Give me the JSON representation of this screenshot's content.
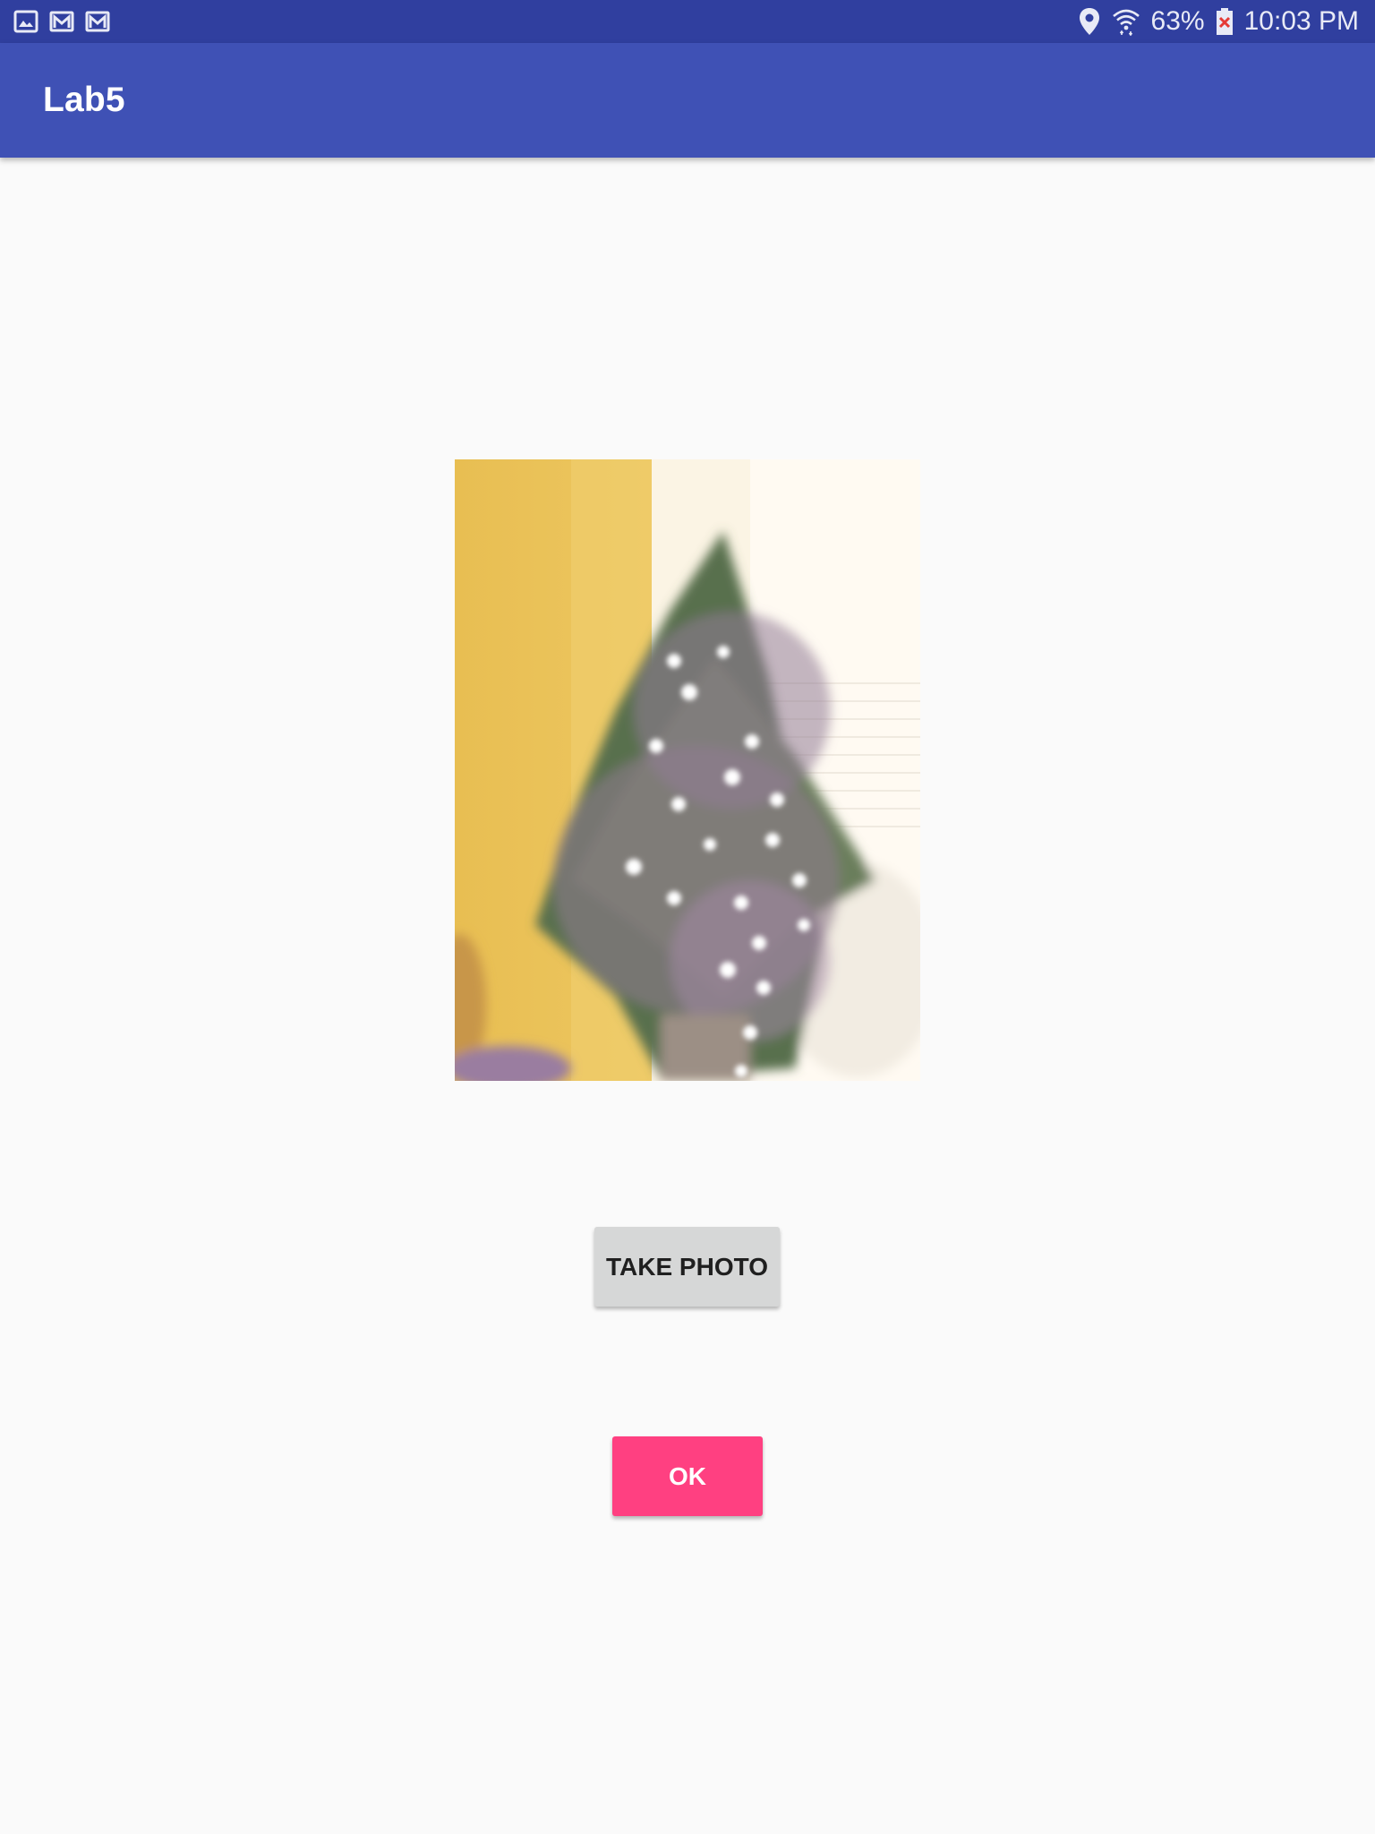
{
  "status_bar": {
    "notification_icons": [
      "gallery-icon",
      "gmail-icon",
      "gmail-icon"
    ],
    "status_icons": [
      "location-icon",
      "wifi-icon",
      "battery-icon"
    ],
    "battery": "63%",
    "time": "10:03 PM"
  },
  "app_bar": {
    "title": "Lab5",
    "color": "#3f51b5"
  },
  "photo": {
    "description_icon": "photo-icon"
  },
  "buttons": {
    "take_photo": "TAKE PHOTO",
    "ok": "OK"
  },
  "colors": {
    "status_bar": "#303f9f",
    "accent": "#ff4081",
    "button_default": "#d6d7d7"
  }
}
